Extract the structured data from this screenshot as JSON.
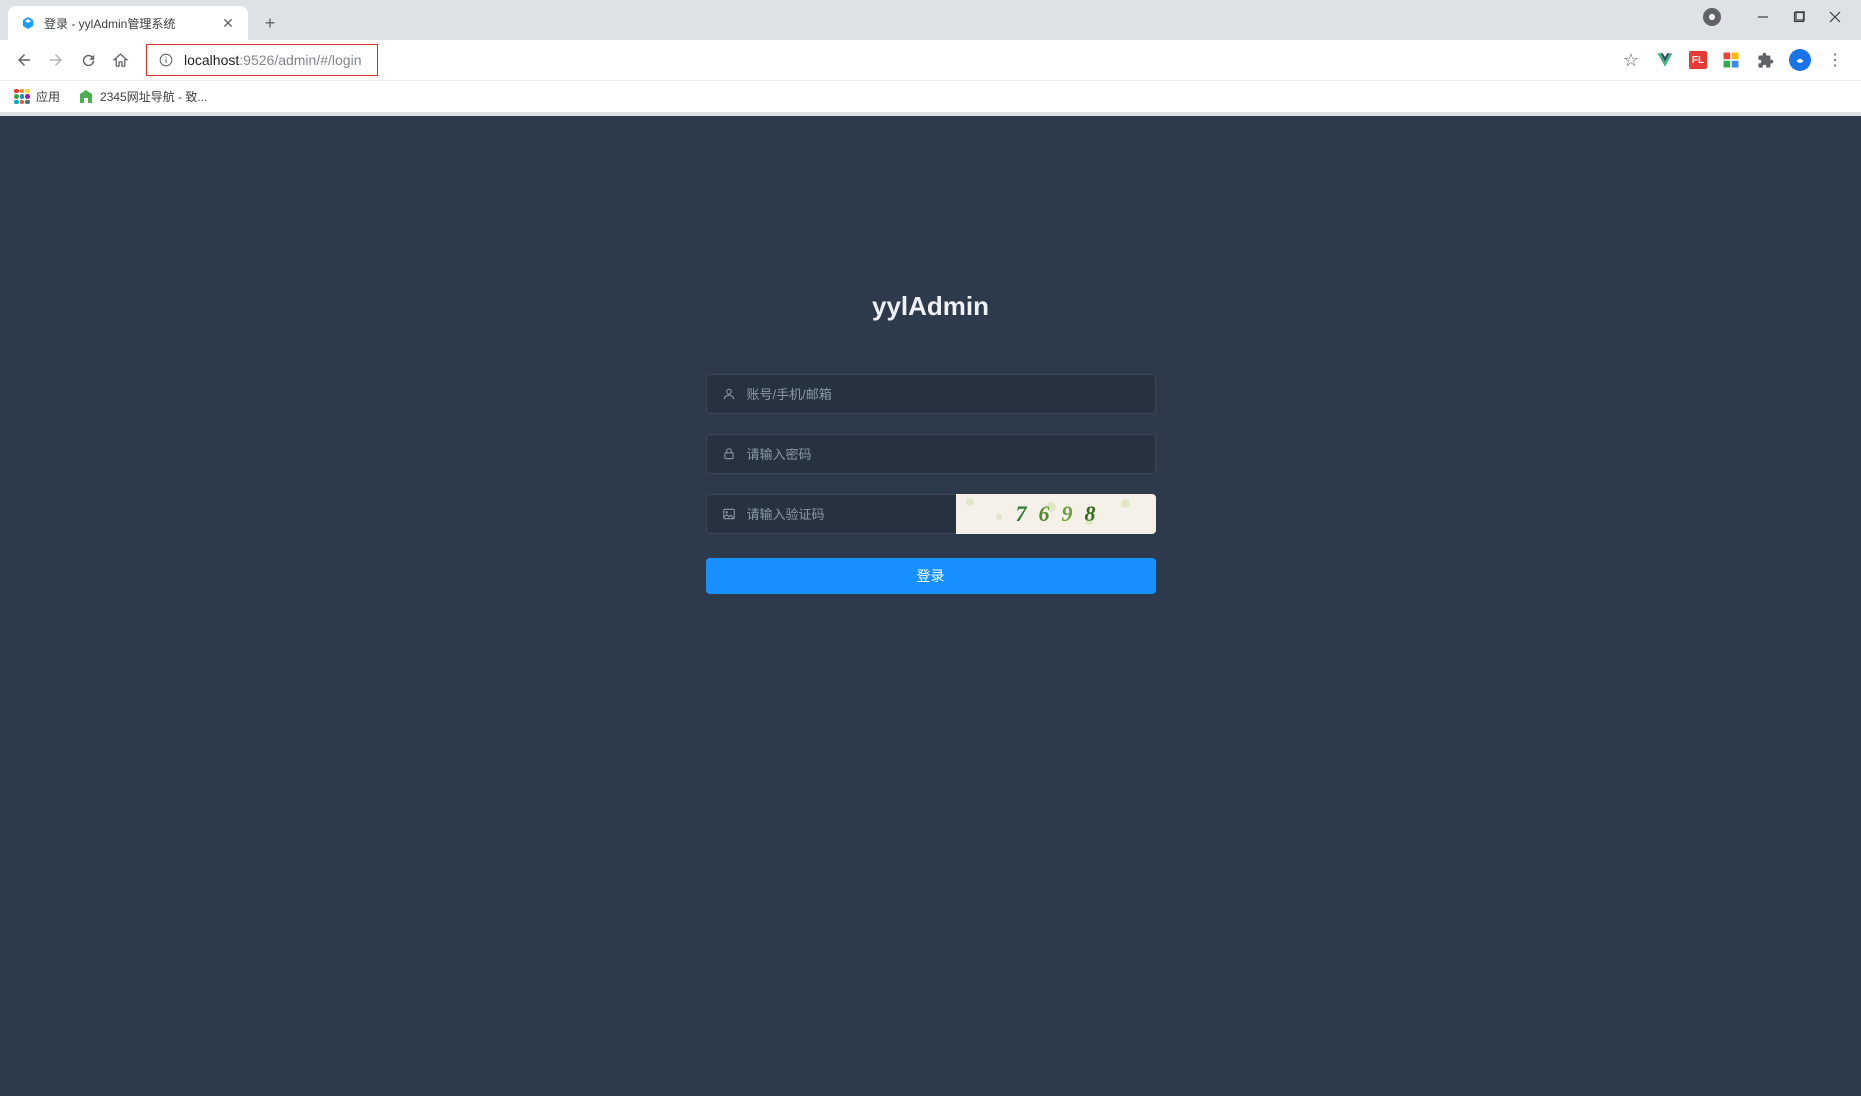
{
  "browser": {
    "tab_title": "登录 - yylAdmin管理系统",
    "url_host": "localhost",
    "url_port": ":9526",
    "url_path": "/admin/#/login"
  },
  "bookmarks": {
    "apps_label": "应用",
    "nav2345_label": "2345网址导航 - 致..."
  },
  "login": {
    "title": "yylAdmin",
    "username_placeholder": "账号/手机/邮箱",
    "password_placeholder": "请输入密码",
    "captcha_placeholder": "请输入验证码",
    "captcha_value": "7698",
    "submit_label": "登录"
  }
}
